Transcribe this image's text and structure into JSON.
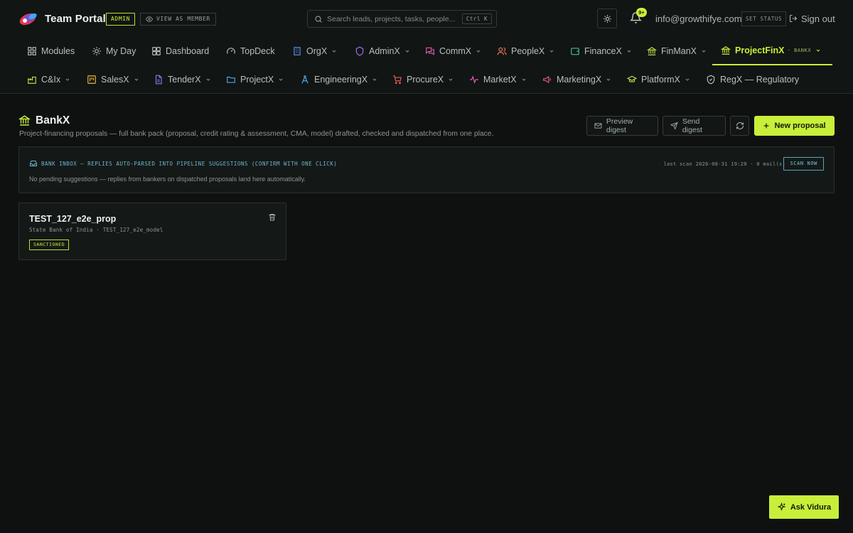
{
  "header": {
    "brand": "Team Portal",
    "role_badge": "ADMIN",
    "view_as_member": "VIEW AS MEMBER",
    "search_placeholder": "Search leads, projects, tasks, people...",
    "search_shortcut": "Ctrl K",
    "notifications_count": "9+",
    "user_email": "info@growthifye.com",
    "set_status": "SET STATUS",
    "sign_out": "Sign out"
  },
  "nav_row1": [
    {
      "label": "Modules",
      "icon": "grid-icon"
    },
    {
      "label": "My Day",
      "icon": "sun-icon"
    },
    {
      "label": "Dashboard",
      "icon": "dashboard-icon"
    },
    {
      "label": "TopDeck",
      "icon": "gauge-icon"
    },
    {
      "label": "OrgX",
      "icon": "building-icon",
      "dropdown": true
    },
    {
      "label": "AdminX",
      "icon": "shield-icon",
      "dropdown": true
    },
    {
      "label": "CommX",
      "icon": "chat-icon",
      "dropdown": true
    },
    {
      "label": "PeopleX",
      "icon": "people-icon",
      "dropdown": true
    },
    {
      "label": "FinanceX",
      "icon": "wallet-icon",
      "dropdown": true
    },
    {
      "label": "FinManX",
      "icon": "bank-icon",
      "dropdown": true
    },
    {
      "label": "ProjectFinX",
      "icon": "bank-icon",
      "dropdown": true,
      "active": true,
      "subtag": "· BANKX"
    }
  ],
  "nav_row2": [
    {
      "label": "C&Ix",
      "icon": "factory-icon",
      "dropdown": true
    },
    {
      "label": "SalesX",
      "icon": "board-icon",
      "dropdown": true
    },
    {
      "label": "TenderX",
      "icon": "document-icon",
      "dropdown": true
    },
    {
      "label": "ProjectX",
      "icon": "folder-icon",
      "dropdown": true
    },
    {
      "label": "EngineeringX",
      "icon": "compass-icon",
      "dropdown": true
    },
    {
      "label": "ProcureX",
      "icon": "cart-icon",
      "dropdown": true
    },
    {
      "label": "MarketX",
      "icon": "pulse-icon",
      "dropdown": true
    },
    {
      "label": "MarketingX",
      "icon": "megaphone-icon",
      "dropdown": true
    },
    {
      "label": "PlatformX",
      "icon": "graduation-icon",
      "dropdown": true
    },
    {
      "label": "RegX — Regulatory",
      "icon": "shield-check-icon"
    }
  ],
  "page": {
    "title": "BankX",
    "subtitle": "Project-financing proposals — full bank pack (proposal, credit rating & assessment, CMA, model) drafted, checked and dispatched from one place.",
    "actions": {
      "preview_digest": "Preview digest",
      "send_digest": "Send digest",
      "new_proposal": "New proposal"
    }
  },
  "inbox": {
    "title": "BANK INBOX — REPLIES AUTO-PARSED INTO PIPELINE SUGGESTIONS (CONFIRM WITH ONE CLICK)",
    "empty_message": "No pending suggestions — replies from bankers on dispatched proposals land here automatically.",
    "last_scan": "last scan 2026-08-31 19:20 · 0 mail(s)",
    "scan_now": "SCAN NOW"
  },
  "proposals": [
    {
      "title": "TEST_127_e2e_prop",
      "subtitle": "State Bank of India · TEST_127_e2e_model",
      "status": "SANCTIONED"
    }
  ],
  "assistant": {
    "label": "Ask Vidura"
  },
  "colors": {
    "accent": "#c8ef3a",
    "background": "#0f1111",
    "info": "#6fb4c9"
  }
}
